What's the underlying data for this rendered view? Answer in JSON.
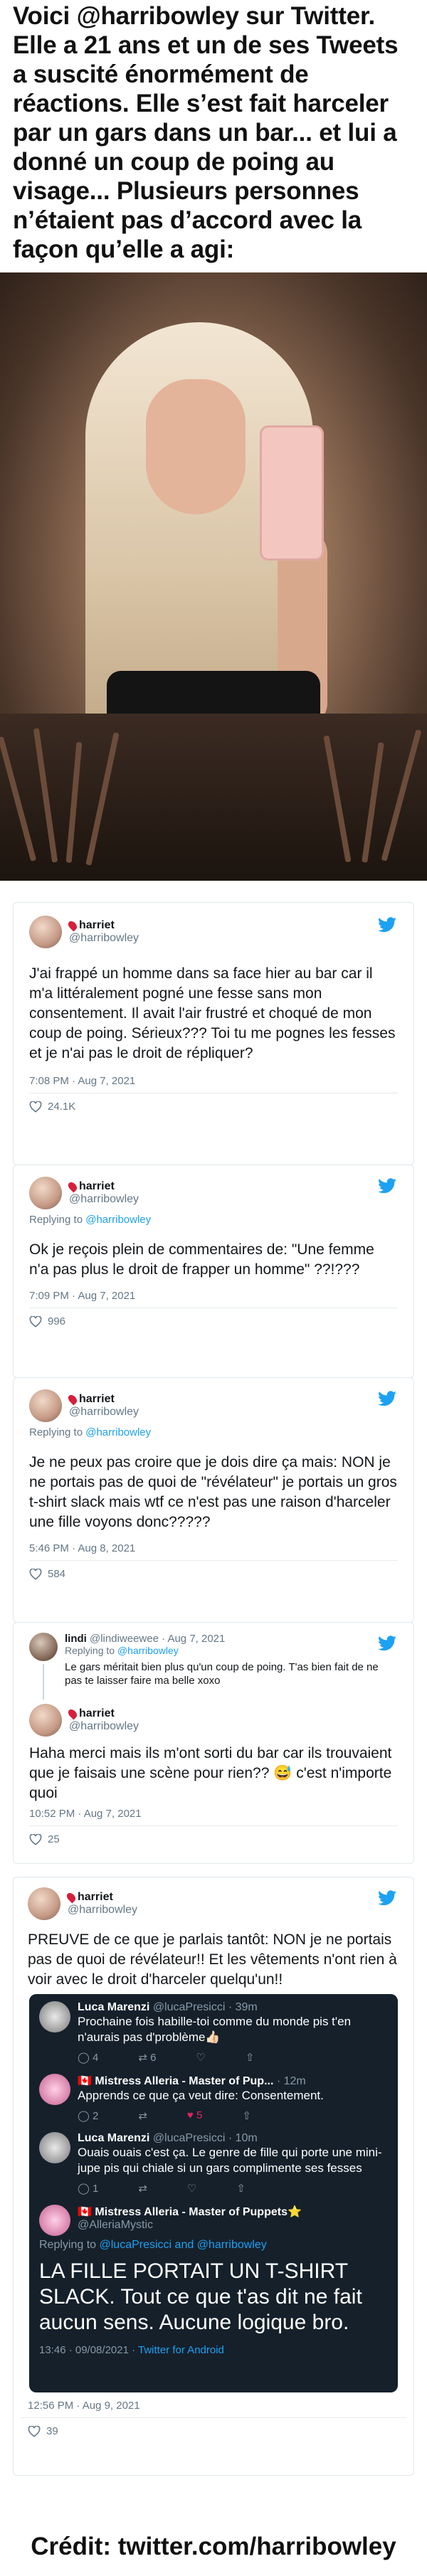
{
  "caption": "Voici @harribowley sur Twitter. Elle a 21 ans et un de ses Tweets a suscité énormément de réactions. Elle s’est fait harceler par un gars dans un bar... et lui a donné un coup de poing au visage... Plusieurs personnes n’étaient pas d’accord avec la façon qu’elle a agi:",
  "colors": {
    "twitter_blue": "#1da1f2",
    "pin_red": "#d61f3b",
    "dark_bg": "#15202b"
  },
  "tweets": [
    {
      "name": "harriet",
      "handle": "@harribowley",
      "text": "J'ai frappé un homme dans sa face hier au bar car il m'a littéralement pogné une fesse sans mon consentement. Il avait l'air frustré et choqué de mon coup de poing. Sérieux??? Toi tu me pognes les fesses et je n'ai pas le droit de répliquer?",
      "meta": "7:08 PM · Aug 7, 2021",
      "likes": "24.1K"
    },
    {
      "name": "harriet",
      "handle": "@harribowley",
      "reply_to_label": "Replying to",
      "reply_to": "@harribowley",
      "text": "Ok je reçois plein de commentaires de: \"Une femme n'a pas plus le droit de frapper un homme\" ??!???",
      "meta": "7:09 PM · Aug 7, 2021",
      "likes": "996"
    },
    {
      "name": "harriet",
      "handle": "@harribowley",
      "reply_to_label": "Replying to",
      "reply_to": "@harribowley",
      "text": "Je ne peux pas croire que je dois dire ça mais: NON je ne portais pas de quoi de \"révélateur\" je portais un gros t-shirt slack mais wtf ce n'est pas une raison d'harceler une fille voyons donc?????",
      "meta": "5:46 PM · Aug 8, 2021",
      "likes": "584"
    }
  ],
  "thread4": {
    "parent_name": "lindi",
    "parent_handle": "@lindiweewee",
    "parent_date": "· Aug 7, 2021",
    "parent_reply_to_label": "Replying to",
    "parent_reply_to": "@harribowley",
    "parent_text": "Le gars méritait bien plus qu'un coup de poing. T'as bien fait de ne pas te laisser faire ma belle xoxo",
    "name": "harriet",
    "handle": "@harribowley",
    "text": "Haha merci mais ils m'ont sorti du bar car ils trouvaient que je faisais une scène pour rien?? 😅 c'est n'importe quoi",
    "meta": "10:52 PM · Aug 7, 2021",
    "likes": "25"
  },
  "tweet5": {
    "name": "harriet",
    "handle": "@harribowley",
    "text": "PREUVE de ce que je parlais tantôt: NON je ne portais pas de quoi de révélateur!! Et les vêtements n'ont rien à voir avec le droit d'harceler quelqu'un!!",
    "meta": "12:56 PM · Aug 9, 2021",
    "likes": "39",
    "embedded": [
      {
        "name": "Luca Marenzi",
        "handle": "@lucaPresicci · 39m",
        "text": "Prochaine fois habille-toi comme du monde pis t'en n'aurais pas d'problème👍🏻",
        "actions": [
          "4",
          "6",
          ""
        ]
      },
      {
        "name": "🇨🇦 Mistress Alleria - Master of Pup...",
        "handle": "· 12m",
        "text": "Apprends ce que ça veut dire: Consentement.",
        "actions": [
          "2",
          "",
          "5"
        ]
      },
      {
        "name": "Luca Marenzi",
        "handle": "@lucaPresicci · 10m",
        "text": "Ouais ouais c'est ça. Le genre de fille qui porte une mini-jupe pis qui chiale si un gars complimente ses fesses",
        "actions": [
          "1",
          "",
          ""
        ]
      }
    ],
    "final": {
      "name": "🇨🇦 Mistress Alleria - Master of Puppets⭐",
      "handle": "@AlleriaMystic",
      "reply_label": "Replying to",
      "reply_to": "@lucaPresicci and @harribowley",
      "text": "LA FILLE PORTAIT UN T-SHIRT SLACK. Tout ce que t'as dit ne fait aucun sens. Aucune logique bro.",
      "meta": "13:46 · 09/08/2021 · ",
      "meta_link": "Twitter for Android"
    }
  },
  "credit": "Crédit: twitter.com/harribowley"
}
